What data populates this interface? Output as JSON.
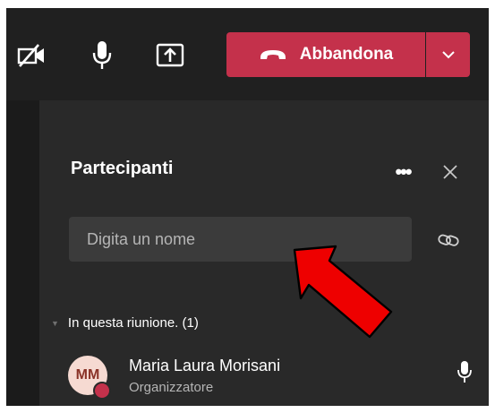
{
  "toolbar": {
    "camera_icon": "camera-off-icon",
    "mic_icon": "microphone-icon",
    "share_icon": "share-screen-icon",
    "leave_label": "Abbandona",
    "leave_icon": "hang-up-icon",
    "leave_options_icon": "chevron-down-icon",
    "accent_color": "#c4314b"
  },
  "panel": {
    "title": "Partecipanti",
    "more_label": "•••",
    "close_icon": "close-icon",
    "search_placeholder": "Digita un nome",
    "link_icon": "copy-link-icon",
    "section_label": "In questa riunione. (1)",
    "participants": [
      {
        "initials": "MM",
        "name": "Maria Laura Morisani",
        "role": "Organizzatore",
        "status": "busy",
        "mic_icon": "microphone-icon"
      }
    ]
  },
  "annotation": {
    "arrow_color": "#ee0000",
    "arrow_target": "search-input"
  }
}
